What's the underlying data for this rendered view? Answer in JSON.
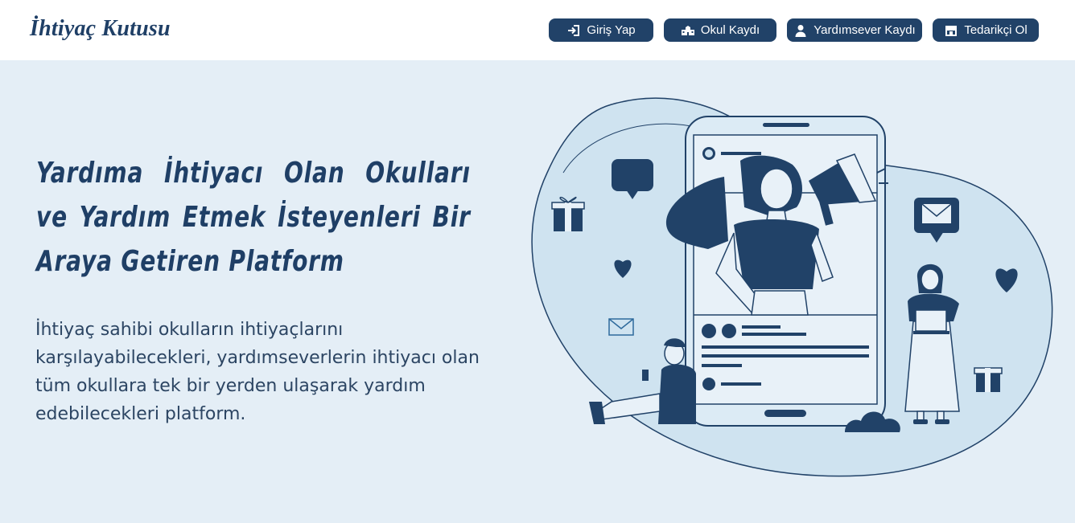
{
  "brand": {
    "name": "İhtiyaç Kutusu"
  },
  "nav": {
    "login": "Giriş Yap",
    "school_register": "Okul Kaydı",
    "donor_register": "Yardımsever Kaydı",
    "supplier": "Tedarikçi Ol"
  },
  "hero": {
    "title": "Yardıma İhtiyacı Olan Okulları ve Yardım Etmek İsteyenleri Bir Araya Getiren Platform",
    "description": "İhtiyaç sahibi okulların ihtiyaçlarını karşılayabilecekleri, yardımseverlerin ihtiyacı olan tüm okullara tek bir yerden  ulaşarak yardım edebilecekleri platform."
  },
  "colors": {
    "primary": "#214268",
    "background": "#e4eef6",
    "illustration_blob": "#cfe3f0"
  },
  "icons": {
    "login": "sign-in-icon",
    "school": "school-icon",
    "donor": "user-icon",
    "supplier": "store-icon"
  }
}
